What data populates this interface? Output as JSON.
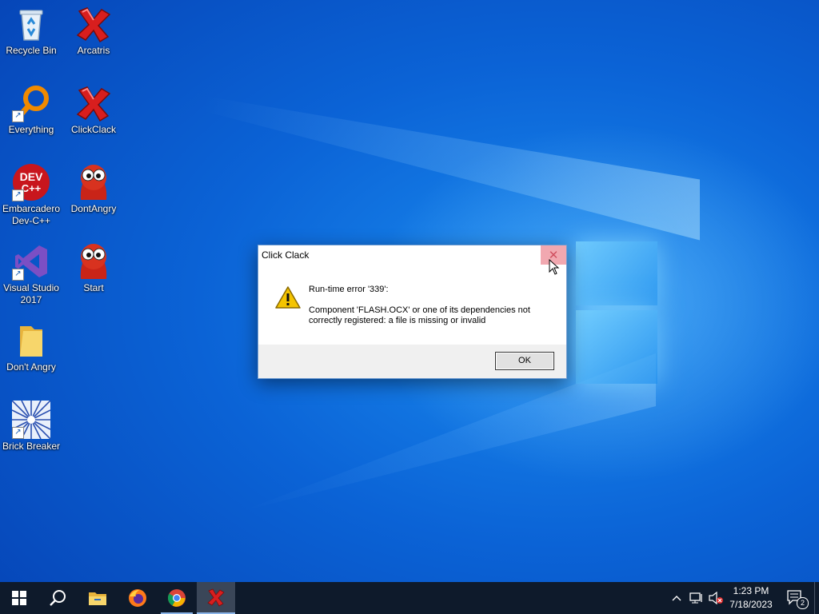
{
  "desktop": {
    "icons": [
      {
        "label": "Recycle Bin",
        "icon": "recycle-bin-icon"
      },
      {
        "label": "Arcatris",
        "icon": "red-x-icon"
      },
      {
        "label": "Everything",
        "icon": "magnifier-icon"
      },
      {
        "label": "ClickClack",
        "icon": "red-x-icon"
      },
      {
        "label": "Embarcadero Dev-C++",
        "icon": "dev-cpp-icon",
        "badge": "DEV C++"
      },
      {
        "label": "DontAngry",
        "icon": "red-creature-icon"
      },
      {
        "label": "Visual Studio 2017",
        "icon": "visual-studio-icon"
      },
      {
        "label": "Start",
        "icon": "red-creature-icon"
      },
      {
        "label": "Don't Angry",
        "icon": "folder-icon"
      },
      {
        "label": "Brick Breaker",
        "icon": "starburst-icon"
      }
    ]
  },
  "dialog": {
    "title": "Click Clack",
    "close_glyph": "✕",
    "line1": "Run-time error '339':",
    "line2": "Component 'FLASH.OCX' or one of its dependencies not correctly registered: a file is missing or invalid",
    "ok_label": "OK"
  },
  "taskbar": {
    "apps": [
      "start-icon",
      "search-icon",
      "file-explorer-icon",
      "firefox-icon",
      "chrome-icon",
      "clickclack-icon"
    ],
    "active_app": "clickclack-icon",
    "time": "1:23 PM",
    "date": "7/18/2023",
    "notification_count": "2"
  },
  "colors": {
    "desktop_blue": "#0b63d6",
    "taskbar": "#0e1a2b",
    "close_hover": "#f1a8b0"
  }
}
